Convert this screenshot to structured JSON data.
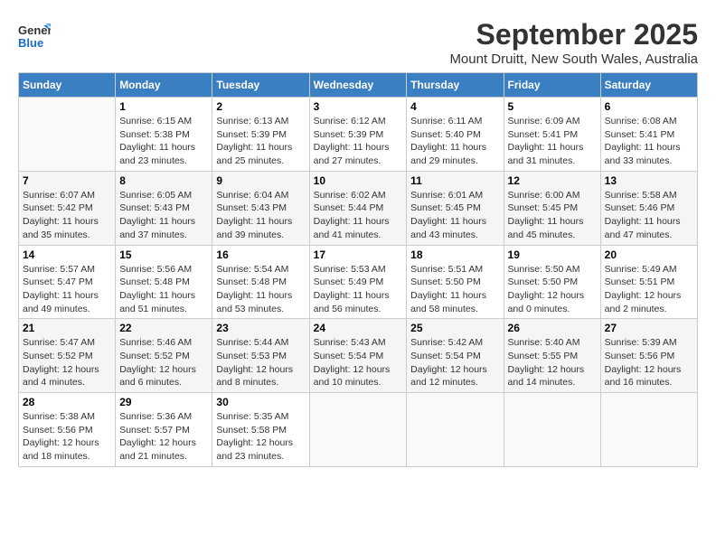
{
  "header": {
    "logo_line1": "General",
    "logo_line2": "Blue",
    "month": "September 2025",
    "location": "Mount Druitt, New South Wales, Australia"
  },
  "days_of_week": [
    "Sunday",
    "Monday",
    "Tuesday",
    "Wednesday",
    "Thursday",
    "Friday",
    "Saturday"
  ],
  "weeks": [
    [
      {
        "day": "",
        "content": ""
      },
      {
        "day": "1",
        "content": "Sunrise: 6:15 AM\nSunset: 5:38 PM\nDaylight: 11 hours\nand 23 minutes."
      },
      {
        "day": "2",
        "content": "Sunrise: 6:13 AM\nSunset: 5:39 PM\nDaylight: 11 hours\nand 25 minutes."
      },
      {
        "day": "3",
        "content": "Sunrise: 6:12 AM\nSunset: 5:39 PM\nDaylight: 11 hours\nand 27 minutes."
      },
      {
        "day": "4",
        "content": "Sunrise: 6:11 AM\nSunset: 5:40 PM\nDaylight: 11 hours\nand 29 minutes."
      },
      {
        "day": "5",
        "content": "Sunrise: 6:09 AM\nSunset: 5:41 PM\nDaylight: 11 hours\nand 31 minutes."
      },
      {
        "day": "6",
        "content": "Sunrise: 6:08 AM\nSunset: 5:41 PM\nDaylight: 11 hours\nand 33 minutes."
      }
    ],
    [
      {
        "day": "7",
        "content": "Sunrise: 6:07 AM\nSunset: 5:42 PM\nDaylight: 11 hours\nand 35 minutes."
      },
      {
        "day": "8",
        "content": "Sunrise: 6:05 AM\nSunset: 5:43 PM\nDaylight: 11 hours\nand 37 minutes."
      },
      {
        "day": "9",
        "content": "Sunrise: 6:04 AM\nSunset: 5:43 PM\nDaylight: 11 hours\nand 39 minutes."
      },
      {
        "day": "10",
        "content": "Sunrise: 6:02 AM\nSunset: 5:44 PM\nDaylight: 11 hours\nand 41 minutes."
      },
      {
        "day": "11",
        "content": "Sunrise: 6:01 AM\nSunset: 5:45 PM\nDaylight: 11 hours\nand 43 minutes."
      },
      {
        "day": "12",
        "content": "Sunrise: 6:00 AM\nSunset: 5:45 PM\nDaylight: 11 hours\nand 45 minutes."
      },
      {
        "day": "13",
        "content": "Sunrise: 5:58 AM\nSunset: 5:46 PM\nDaylight: 11 hours\nand 47 minutes."
      }
    ],
    [
      {
        "day": "14",
        "content": "Sunrise: 5:57 AM\nSunset: 5:47 PM\nDaylight: 11 hours\nand 49 minutes."
      },
      {
        "day": "15",
        "content": "Sunrise: 5:56 AM\nSunset: 5:48 PM\nDaylight: 11 hours\nand 51 minutes."
      },
      {
        "day": "16",
        "content": "Sunrise: 5:54 AM\nSunset: 5:48 PM\nDaylight: 11 hours\nand 53 minutes."
      },
      {
        "day": "17",
        "content": "Sunrise: 5:53 AM\nSunset: 5:49 PM\nDaylight: 11 hours\nand 56 minutes."
      },
      {
        "day": "18",
        "content": "Sunrise: 5:51 AM\nSunset: 5:50 PM\nDaylight: 11 hours\nand 58 minutes."
      },
      {
        "day": "19",
        "content": "Sunrise: 5:50 AM\nSunset: 5:50 PM\nDaylight: 12 hours\nand 0 minutes."
      },
      {
        "day": "20",
        "content": "Sunrise: 5:49 AM\nSunset: 5:51 PM\nDaylight: 12 hours\nand 2 minutes."
      }
    ],
    [
      {
        "day": "21",
        "content": "Sunrise: 5:47 AM\nSunset: 5:52 PM\nDaylight: 12 hours\nand 4 minutes."
      },
      {
        "day": "22",
        "content": "Sunrise: 5:46 AM\nSunset: 5:52 PM\nDaylight: 12 hours\nand 6 minutes."
      },
      {
        "day": "23",
        "content": "Sunrise: 5:44 AM\nSunset: 5:53 PM\nDaylight: 12 hours\nand 8 minutes."
      },
      {
        "day": "24",
        "content": "Sunrise: 5:43 AM\nSunset: 5:54 PM\nDaylight: 12 hours\nand 10 minutes."
      },
      {
        "day": "25",
        "content": "Sunrise: 5:42 AM\nSunset: 5:54 PM\nDaylight: 12 hours\nand 12 minutes."
      },
      {
        "day": "26",
        "content": "Sunrise: 5:40 AM\nSunset: 5:55 PM\nDaylight: 12 hours\nand 14 minutes."
      },
      {
        "day": "27",
        "content": "Sunrise: 5:39 AM\nSunset: 5:56 PM\nDaylight: 12 hours\nand 16 minutes."
      }
    ],
    [
      {
        "day": "28",
        "content": "Sunrise: 5:38 AM\nSunset: 5:56 PM\nDaylight: 12 hours\nand 18 minutes."
      },
      {
        "day": "29",
        "content": "Sunrise: 5:36 AM\nSunset: 5:57 PM\nDaylight: 12 hours\nand 21 minutes."
      },
      {
        "day": "30",
        "content": "Sunrise: 5:35 AM\nSunset: 5:58 PM\nDaylight: 12 hours\nand 23 minutes."
      },
      {
        "day": "",
        "content": ""
      },
      {
        "day": "",
        "content": ""
      },
      {
        "day": "",
        "content": ""
      },
      {
        "day": "",
        "content": ""
      }
    ]
  ]
}
